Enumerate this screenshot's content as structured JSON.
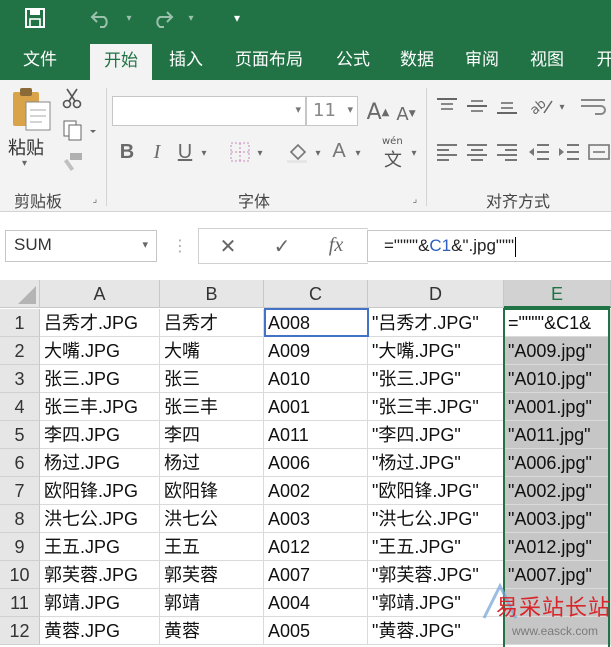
{
  "quick_access": {
    "save": "save-icon",
    "undo": "undo-icon",
    "redo": "redo-icon",
    "customize": "▾"
  },
  "tabs": [
    "文件",
    "开始",
    "插入",
    "页面布局",
    "公式",
    "数据",
    "审阅",
    "视图",
    "开"
  ],
  "ribbon": {
    "clipboard": {
      "paste_label": "粘贴",
      "group_label": "剪贴板"
    },
    "font": {
      "font_name": "",
      "font_size": "11",
      "bold": "B",
      "italic": "I",
      "underline": "U",
      "font_color": "A",
      "wen": "wén",
      "wen_char": "文",
      "group_label": "字体"
    },
    "alignment": {
      "group_label": "对齐方式"
    }
  },
  "formula_bar": {
    "name_box": "SUM",
    "cancel": "✕",
    "enter": "✓",
    "fx": "fx",
    "formula_prefix": "=\"\"\"\"&",
    "formula_ref": "C1",
    "formula_suffix": "&\".jpg\"\"\""
  },
  "grid": {
    "columns": [
      "A",
      "B",
      "C",
      "D",
      "E"
    ],
    "rows": [
      {
        "n": "1",
        "a": "吕秀才.JPG",
        "b": "吕秀才",
        "c": "A008",
        "d": "\"吕秀才.JPG\"",
        "e": "=\"\"\"\"&C1&"
      },
      {
        "n": "2",
        "a": "大嘴.JPG",
        "b": "大嘴",
        "c": "A009",
        "d": "\"大嘴.JPG\"",
        "e": "\"A009.jpg\""
      },
      {
        "n": "3",
        "a": "张三.JPG",
        "b": "张三",
        "c": "A010",
        "d": "\"张三.JPG\"",
        "e": "\"A010.jpg\""
      },
      {
        "n": "4",
        "a": "张三丰.JPG",
        "b": "张三丰",
        "c": "A001",
        "d": "\"张三丰.JPG\"",
        "e": "\"A001.jpg\""
      },
      {
        "n": "5",
        "a": "李四.JPG",
        "b": "李四",
        "c": "A011",
        "d": "\"李四.JPG\"",
        "e": "\"A011.jpg\""
      },
      {
        "n": "6",
        "a": "杨过.JPG",
        "b": "杨过",
        "c": "A006",
        "d": "\"杨过.JPG\"",
        "e": "\"A006.jpg\""
      },
      {
        "n": "7",
        "a": "欧阳锋.JPG",
        "b": "欧阳锋",
        "c": "A002",
        "d": "\"欧阳锋.JPG\"",
        "e": "\"A002.jpg\""
      },
      {
        "n": "8",
        "a": "洪七公.JPG",
        "b": "洪七公",
        "c": "A003",
        "d": "\"洪七公.JPG\"",
        "e": "\"A003.jpg\""
      },
      {
        "n": "9",
        "a": "王五.JPG",
        "b": "王五",
        "c": "A012",
        "d": "\"王五.JPG\"",
        "e": "\"A012.jpg\""
      },
      {
        "n": "10",
        "a": "郭芙蓉.JPG",
        "b": "郭芙蓉",
        "c": "A007",
        "d": "\"郭芙蓉.JPG\"",
        "e": "\"A007.jpg\""
      },
      {
        "n": "11",
        "a": "郭靖.JPG",
        "b": "郭靖",
        "c": "A004",
        "d": "\"郭靖.JPG\"",
        "e": ""
      },
      {
        "n": "12",
        "a": "黄蓉.JPG",
        "b": "黄蓉",
        "c": "A005",
        "d": "\"黄蓉.JPG\"",
        "e": ""
      }
    ]
  },
  "watermark": {
    "text": "易采站长站",
    "url": "www.easck.com"
  },
  "colors": {
    "excel_green": "#217346",
    "ribbon_bg": "#f3f3f3",
    "header_bg": "#e6e6e6",
    "selection_gray": "#c6c6c6",
    "cell_ref_blue": "#2e5fbf",
    "watermark_red": "#d9262b"
  }
}
